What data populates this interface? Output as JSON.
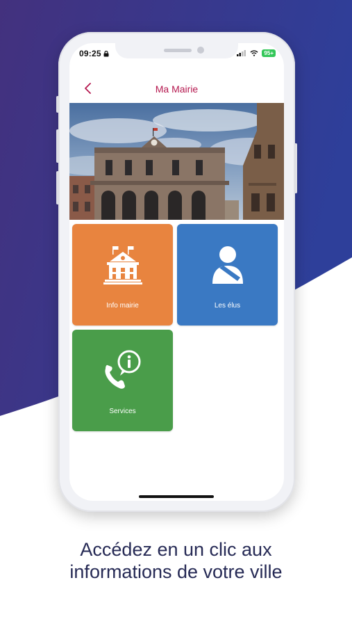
{
  "status_bar": {
    "time": "09:25",
    "battery": "95+"
  },
  "nav": {
    "title": "Ma Mairie",
    "back_icon": "chevron-left-icon"
  },
  "tiles": [
    {
      "label": "Info mairie",
      "color": "#e8843f",
      "icon": "town-hall-icon"
    },
    {
      "label": "Les élus",
      "color": "#3a79c3",
      "icon": "elected-official-icon"
    },
    {
      "label": "Services",
      "color": "#4a9d4a",
      "icon": "phone-info-icon"
    }
  ],
  "caption": {
    "line1": "Accédez en un clic aux",
    "line2": "informations de votre ville"
  },
  "colors": {
    "brand_purple": "#3b2e84",
    "title_red": "#b5184f",
    "caption_navy": "#262a55"
  }
}
